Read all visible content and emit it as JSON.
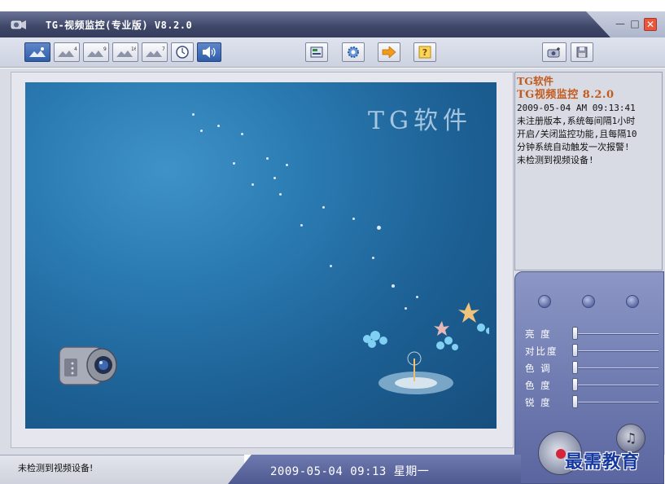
{
  "window": {
    "title": "TG-视频监控(专业版) V8.2.0",
    "minimize_label": "—",
    "maximize_label": "□",
    "close_label": "✕"
  },
  "toolbar": {
    "buttons": [
      {
        "icon": "single-view-icon",
        "badge": ""
      },
      {
        "icon": "quad-view-icon",
        "badge": "4"
      },
      {
        "icon": "nine-view-icon",
        "badge": "9"
      },
      {
        "icon": "sixteen-view-icon",
        "badge": "16"
      },
      {
        "icon": "seven-view-icon",
        "badge": "7"
      },
      {
        "icon": "schedule-clock-icon",
        "badge": ""
      },
      {
        "icon": "speaker-icon",
        "badge": ""
      },
      {
        "icon": "device-list-icon",
        "badge": ""
      },
      {
        "icon": "settings-gear-icon",
        "badge": ""
      },
      {
        "icon": "arrow-forward-icon",
        "badge": ""
      },
      {
        "icon": "help-icon",
        "badge": "?"
      },
      {
        "icon": "snapshot-camera-icon",
        "badge": ""
      },
      {
        "icon": "save-disk-icon",
        "badge": ""
      }
    ]
  },
  "video": {
    "brand_text": "TG软件"
  },
  "info": {
    "line1": "TG软件",
    "line2": "TG视频监控 8.2.0",
    "timestamp": "2009-05-04 AM 09:13:41",
    "msg1": "未注册版本,系统每间隔1小时",
    "msg2": "开启/关闭监控功能,且每隔10",
    "msg3": "分钟系统自动触发一次报警!",
    "msg4": "未检测到视频设备!"
  },
  "controls": {
    "sliders": [
      {
        "label": "亮 度",
        "value": 0
      },
      {
        "label": "对比度",
        "value": 0
      },
      {
        "label": "色 调",
        "value": 0
      },
      {
        "label": "色 度",
        "value": 0
      },
      {
        "label": "锐 度",
        "value": 0
      }
    ],
    "music_glyph": "♫"
  },
  "status": {
    "message": "未检测到视频设备!",
    "clock": "2009-05-04  09:13  星期一"
  },
  "watermark": "最需教育"
}
